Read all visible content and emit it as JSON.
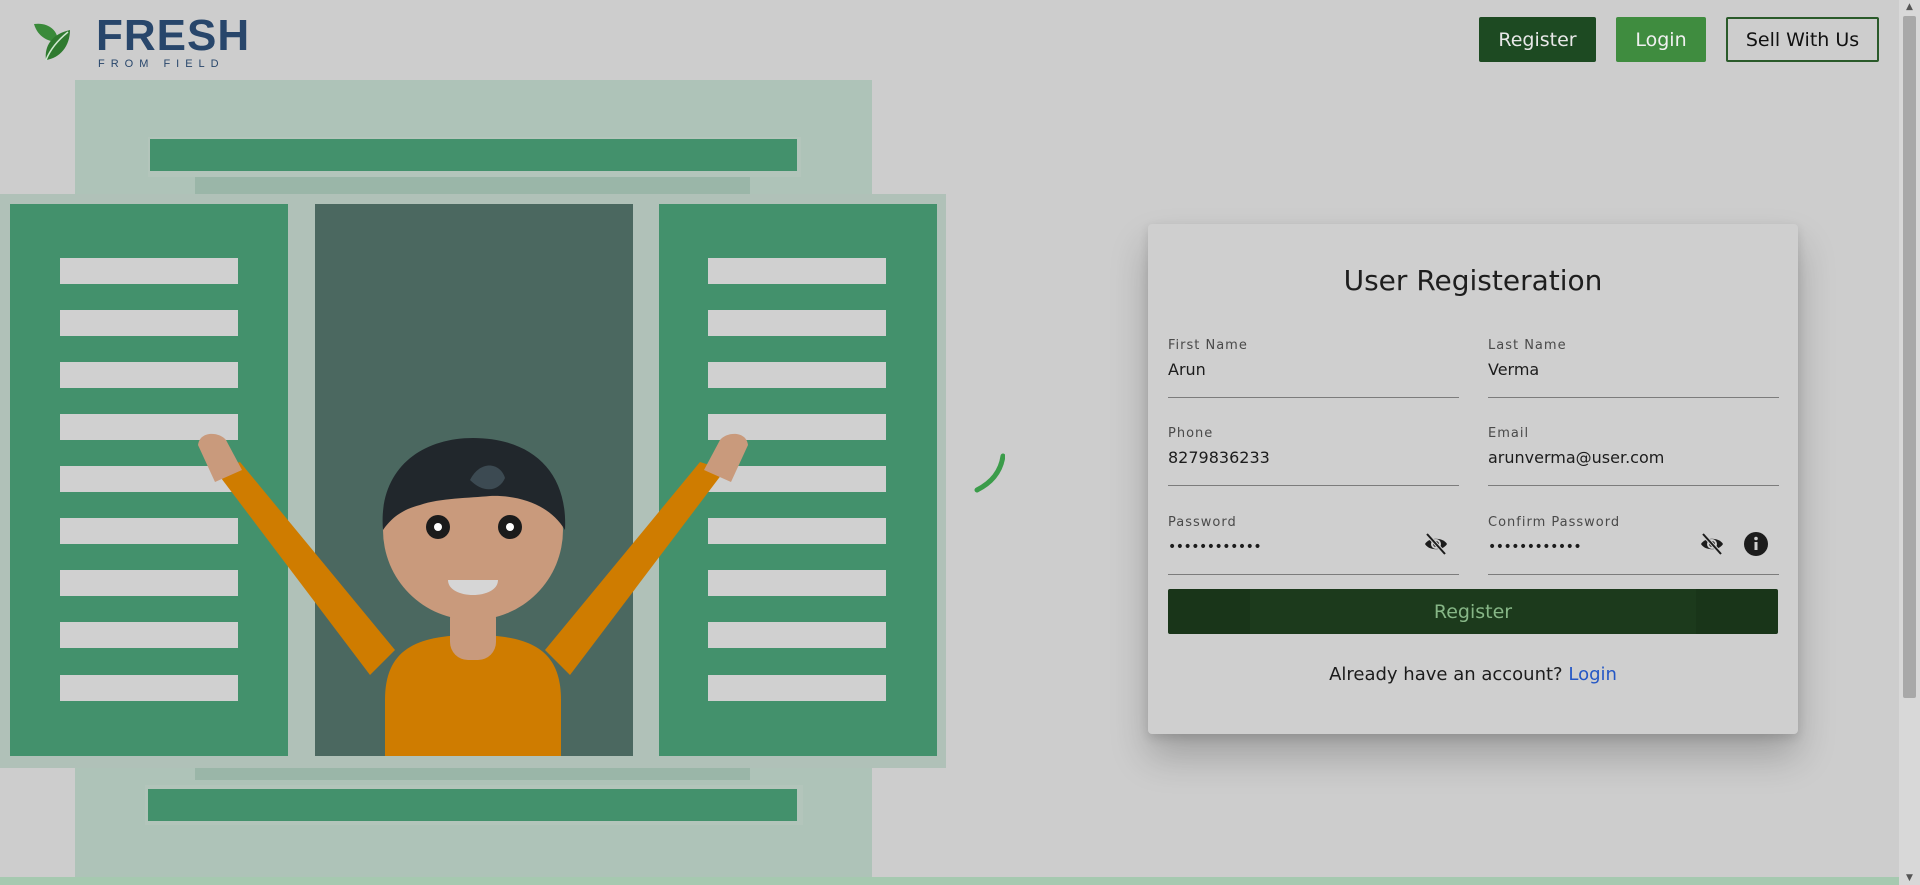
{
  "brand": {
    "name": "FRESH",
    "tagline": "FROM FIELD"
  },
  "nav": {
    "register": "Register",
    "login": "Login",
    "sell": "Sell With Us"
  },
  "form": {
    "title": "User Registeration",
    "first_name": {
      "label": "First Name",
      "value": "Arun"
    },
    "last_name": {
      "label": "Last Name",
      "value": "Verma"
    },
    "phone": {
      "label": "Phone",
      "value": "8279836233"
    },
    "email": {
      "label": "Email",
      "value": "arunverma@user.com"
    },
    "password": {
      "label": "Password",
      "value": "••••••••••••"
    },
    "confirm_password": {
      "label": "Confirm Password",
      "value": "••••••••••••"
    },
    "submit": "Register",
    "footer_text": "Already have an account?",
    "footer_link": "Login"
  },
  "icons": [
    "leaf-icon",
    "eye-off-icon",
    "info-icon",
    "loading-spinner-icon"
  ],
  "colors": {
    "primary_dark": "#1d4a22",
    "primary": "#3f8c3f",
    "shutter": "#43916c",
    "link": "#2457c5"
  }
}
